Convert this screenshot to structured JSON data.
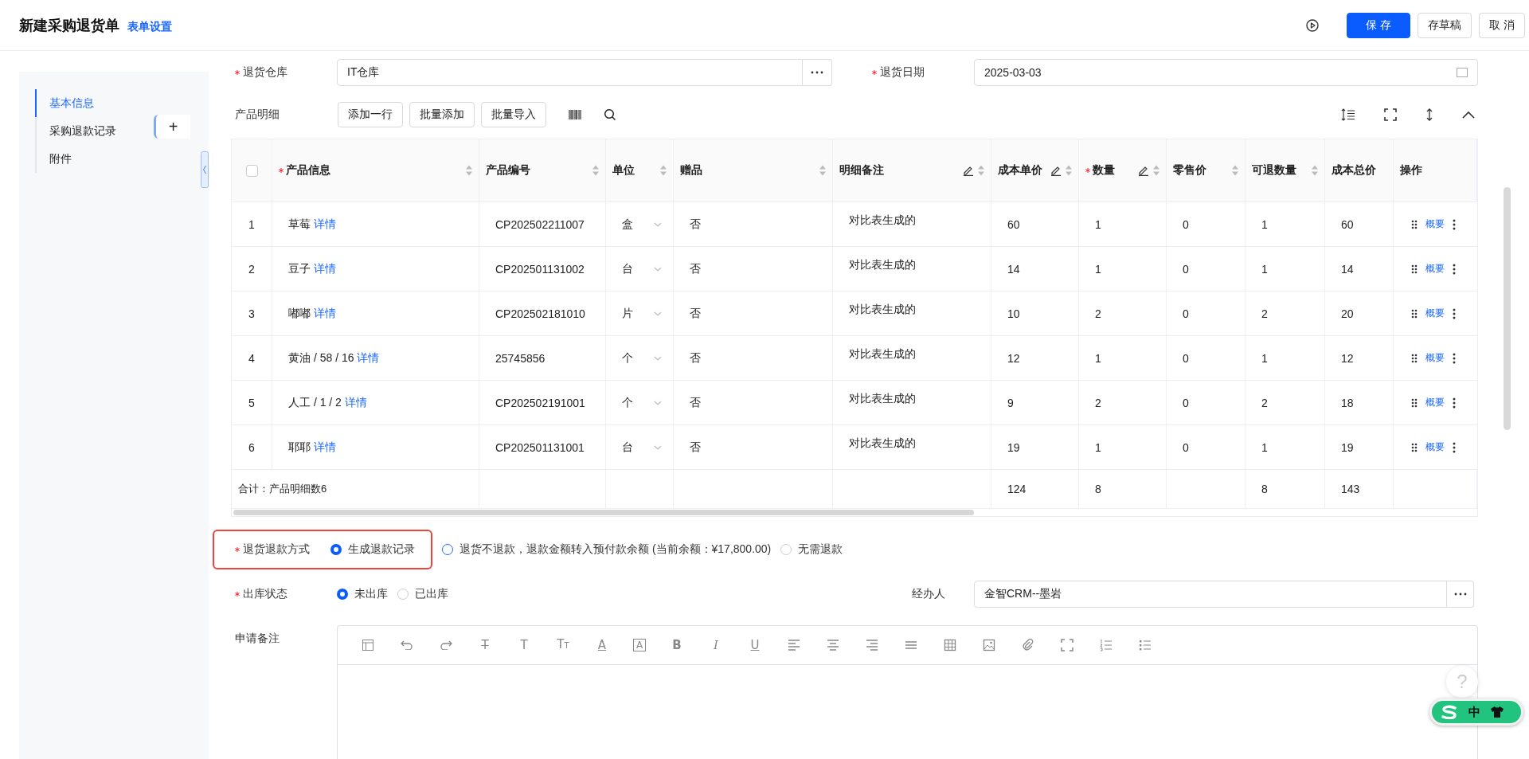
{
  "header": {
    "title": "新建采购退货单",
    "settings_link": "表单设置",
    "buttons": [
      {
        "label": "保 存",
        "kind": "primary"
      },
      {
        "label": "存草稿",
        "kind": "default"
      },
      {
        "label": "取 消",
        "kind": "default"
      }
    ]
  },
  "sidebar": {
    "items": [
      {
        "label": "基本信息",
        "selected": true
      },
      {
        "label": "采购退款记录",
        "selected": false
      },
      {
        "label": "附件",
        "selected": false
      }
    ],
    "add_label": "+"
  },
  "warehouse": {
    "label": "退货仓库",
    "required": true,
    "value": "IT仓库"
  },
  "return_date": {
    "label": "退货日期",
    "required": true,
    "value": "2025-03-03"
  },
  "products": {
    "label": "产品明细",
    "select_all": {
      "checked": false
    },
    "buttons": [
      "添加一行",
      "批量添加",
      "批量导入"
    ],
    "columns": [
      {
        "label": "产品信息",
        "required": true,
        "editable": false,
        "sortable": true
      },
      {
        "label": "产品编号",
        "required": false,
        "editable": false,
        "sortable": true
      },
      {
        "label": "单位",
        "required": false,
        "editable": false,
        "sortable": true
      },
      {
        "label": "赠品",
        "required": false,
        "editable": false,
        "sortable": true
      },
      {
        "label": "明细备注",
        "required": false,
        "editable": true,
        "sortable": true
      },
      {
        "label": "成本单价",
        "required": false,
        "editable": true,
        "sortable": true
      },
      {
        "label": "数量",
        "required": true,
        "editable": true,
        "sortable": true
      },
      {
        "label": "零售价",
        "required": false,
        "editable": false,
        "sortable": true
      },
      {
        "label": "可退数量",
        "required": false,
        "editable": false,
        "sortable": true
      },
      {
        "label": "成本总价",
        "required": false,
        "editable": false,
        "sortable": false
      },
      {
        "label": "操作",
        "required": false,
        "editable": false,
        "sortable": false
      }
    ],
    "rows": [
      {
        "index": "1",
        "name": "草莓",
        "link": "详情",
        "code": "CP202502211007",
        "unit": "盒",
        "gift": "否",
        "note": "对比表生成的",
        "cost_price": "60",
        "qty": "1",
        "retail": "0",
        "returnable": "1",
        "cost_total": "60",
        "action": "概要"
      },
      {
        "index": "2",
        "name": "豆子",
        "link": "详情",
        "code": "CP202501131002",
        "unit": "台",
        "gift": "否",
        "note": "对比表生成的",
        "cost_price": "14",
        "qty": "1",
        "retail": "0",
        "returnable": "1",
        "cost_total": "14",
        "action": "概要"
      },
      {
        "index": "3",
        "name": "嘟嘟",
        "link": "详情",
        "code": "CP202502181010",
        "unit": "片",
        "gift": "否",
        "note": "对比表生成的",
        "cost_price": "10",
        "qty": "2",
        "retail": "0",
        "returnable": "2",
        "cost_total": "20",
        "action": "概要"
      },
      {
        "index": "4",
        "name": "黄油 / 58 / 16",
        "link": "详情",
        "code": "25745856",
        "unit": "个",
        "gift": "否",
        "note": "对比表生成的",
        "cost_price": "12",
        "qty": "1",
        "retail": "0",
        "returnable": "1",
        "cost_total": "12",
        "action": "概要"
      },
      {
        "index": "5",
        "name": "人工 / 1 / 2",
        "link": "详情",
        "code": "CP202502191001",
        "unit": "个",
        "gift": "否",
        "note": "对比表生成的",
        "cost_price": "9",
        "qty": "2",
        "retail": "0",
        "returnable": "2",
        "cost_total": "18",
        "action": "概要"
      },
      {
        "index": "6",
        "name": "耶耶",
        "link": "详情",
        "code": "CP202501131001",
        "unit": "台",
        "gift": "否",
        "note": "对比表生成的",
        "cost_price": "19",
        "qty": "1",
        "retail": "0",
        "returnable": "1",
        "cost_total": "19",
        "action": "概要"
      }
    ],
    "total": {
      "label": "合计：产品明细数6",
      "cost_price": "124",
      "qty": "8",
      "returnable": "8",
      "cost_total": "143"
    }
  },
  "refund_method": {
    "label": "退货退款方式",
    "required": true,
    "highlighted": true,
    "options": [
      {
        "label": "生成退款记录",
        "selected": true
      },
      {
        "label": "退货不退款，退款金额转入预付款余额 (当前余额：¥17,800.00)",
        "selected": false
      },
      {
        "label": "无需退款",
        "selected": false
      }
    ]
  },
  "stock_status": {
    "label": "出库状态",
    "required": true,
    "options": [
      {
        "label": "未出库",
        "selected": true
      },
      {
        "label": "已出库",
        "selected": false
      }
    ]
  },
  "handler": {
    "label": "经办人",
    "value": "金智CRM--墨岩"
  },
  "remark": {
    "label": "申请备注",
    "tools": [
      {
        "kind": "layout"
      },
      {
        "kind": "undo"
      },
      {
        "kind": "redo"
      },
      {
        "kind": "strike",
        "label": "T"
      },
      {
        "kind": "text",
        "label": "T"
      },
      {
        "kind": "font-size",
        "label": "TT"
      },
      {
        "kind": "font-color",
        "label": "A"
      },
      {
        "kind": "background",
        "label": "A"
      },
      {
        "kind": "bold",
        "label": "B"
      },
      {
        "kind": "italic",
        "label": "I"
      },
      {
        "kind": "underline",
        "label": "U"
      },
      {
        "kind": "align-left"
      },
      {
        "kind": "align-center"
      },
      {
        "kind": "align-right"
      },
      {
        "kind": "justify"
      },
      {
        "kind": "table"
      },
      {
        "kind": "image"
      },
      {
        "kind": "attachment"
      },
      {
        "kind": "fullscreen"
      },
      {
        "kind": "ordered-list"
      },
      {
        "kind": "bullet-list"
      }
    ]
  },
  "help": {
    "label": "?"
  },
  "ime": {
    "label": "中"
  }
}
